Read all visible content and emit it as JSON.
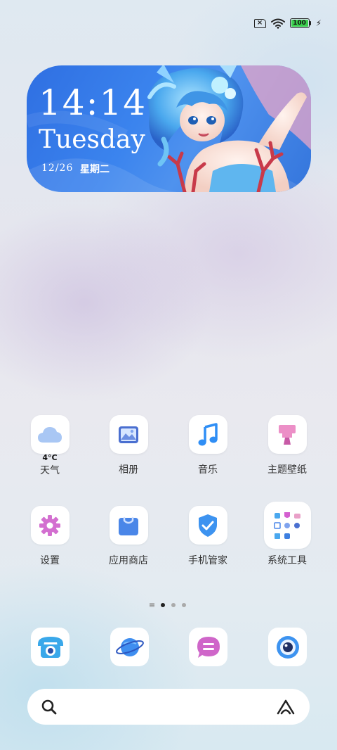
{
  "status_bar": {
    "sim_icon": "no-sim-icon",
    "wifi_icon": "wifi-icon",
    "battery_level": "100",
    "battery_fraction": 1.0,
    "battery_color": "#3ccf4e",
    "charging_icon": "charging-bolt-icon"
  },
  "clock_widget": {
    "time": "14:14",
    "day": "Tuesday",
    "date": "12/26",
    "weekday": "星期二",
    "art_icon": "mermaid-character-art"
  },
  "apps": [
    {
      "label": "天气",
      "icon": "weather-cloud-icon",
      "temp": "4°C"
    },
    {
      "label": "相册",
      "icon": "gallery-icon"
    },
    {
      "label": "音乐",
      "icon": "music-note-icon"
    },
    {
      "label": "主题壁纸",
      "icon": "theme-brush-icon"
    },
    {
      "label": "设置",
      "icon": "gear-icon"
    },
    {
      "label": "应用商店",
      "icon": "app-store-bag-icon"
    },
    {
      "label": "手机管家",
      "icon": "shield-check-icon"
    },
    {
      "label": "系统工具",
      "icon": "system-tools-folder-icon"
    }
  ],
  "page_indicator": {
    "pages": 3,
    "current": 1
  },
  "dock": [
    {
      "icon": "phone-icon"
    },
    {
      "icon": "browser-planet-icon"
    },
    {
      "icon": "messages-icon"
    },
    {
      "icon": "camera-icon"
    }
  ],
  "search_bar": {
    "search_icon": "search-icon",
    "assistant_icon": "assistant-icon"
  },
  "colors": {
    "widget_blue": "#3b84ee",
    "music_blue": "#2f8ef5",
    "pink": "#d36fd0",
    "store_blue": "#4a86e8"
  }
}
